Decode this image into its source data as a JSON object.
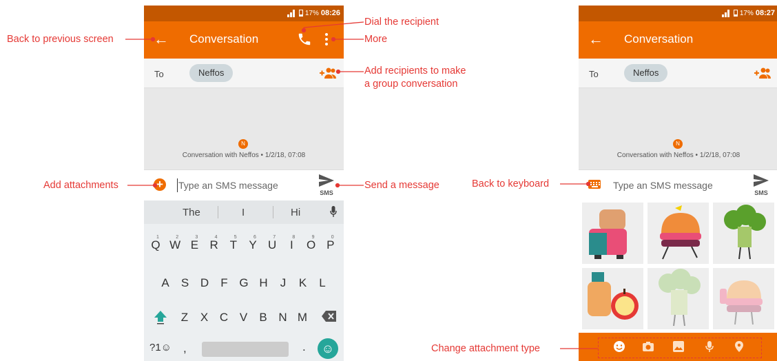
{
  "phone_left": {
    "status": {
      "battery": "17%",
      "time": "08:26"
    },
    "appbar": {
      "title": "Conversation",
      "back_icon": "arrow-left-icon",
      "call_icon": "phone-icon",
      "more_icon": "more-vert-icon"
    },
    "to_row": {
      "label": "To",
      "recipient": "Neffos",
      "add_icon": "add-people-icon"
    },
    "conversation": {
      "avatar_letter": "N",
      "info": "Conversation with Neffos • 1/2/18, 07:08"
    },
    "compose": {
      "placeholder": "Type an SMS message",
      "send_label": "SMS",
      "attach_icon": "plus-circle-icon"
    },
    "keyboard": {
      "suggestions": [
        "The",
        "I",
        "Hi"
      ],
      "row1": [
        "Q",
        "W",
        "E",
        "R",
        "T",
        "Y",
        "U",
        "I",
        "O",
        "P"
      ],
      "row1_nums": [
        "1",
        "2",
        "3",
        "4",
        "5",
        "6",
        "7",
        "8",
        "9",
        "0"
      ],
      "row2": [
        "A",
        "S",
        "D",
        "F",
        "G",
        "H",
        "J",
        "K",
        "L"
      ],
      "row3": [
        "Z",
        "X",
        "C",
        "V",
        "B",
        "N",
        "M"
      ],
      "symbols_key": "?1☺",
      "comma": ",",
      "period": "."
    }
  },
  "phone_right": {
    "status": {
      "battery": "17%",
      "time": "08:27"
    },
    "appbar": {
      "title": "Conversation"
    },
    "to_row": {
      "label": "To",
      "recipient": "Neffos"
    },
    "conversation": {
      "avatar_letter": "N",
      "info": "Conversation with Neffos • 1/2/18, 07:08"
    },
    "compose": {
      "placeholder": "Type an SMS message",
      "send_label": "SMS",
      "keyboard_icon": "keyboard-icon"
    },
    "stickers": [
      "toast-toaster-sticker",
      "burger-sticker",
      "broccoli-sticker",
      "bread-apple-sticker",
      "broccoli-faded-sticker",
      "burger-faded-sticker"
    ],
    "attachment_tray": [
      "emoji-icon",
      "camera-icon",
      "image-icon",
      "mic-icon",
      "location-icon"
    ]
  },
  "callouts": {
    "back": "Back to previous screen",
    "dial": "Dial the recipient",
    "more": "More",
    "add_recipients_1": "Add recipients to make",
    "add_recipients_2": "a group conversation",
    "attachments": "Add attachments",
    "send": "Send a message",
    "back_keyboard": "Back to keyboard",
    "change_type": "Change attachment type"
  },
  "colors": {
    "accent": "#ef6c00",
    "statusbar": "#c35700",
    "callout": "#e53935"
  }
}
